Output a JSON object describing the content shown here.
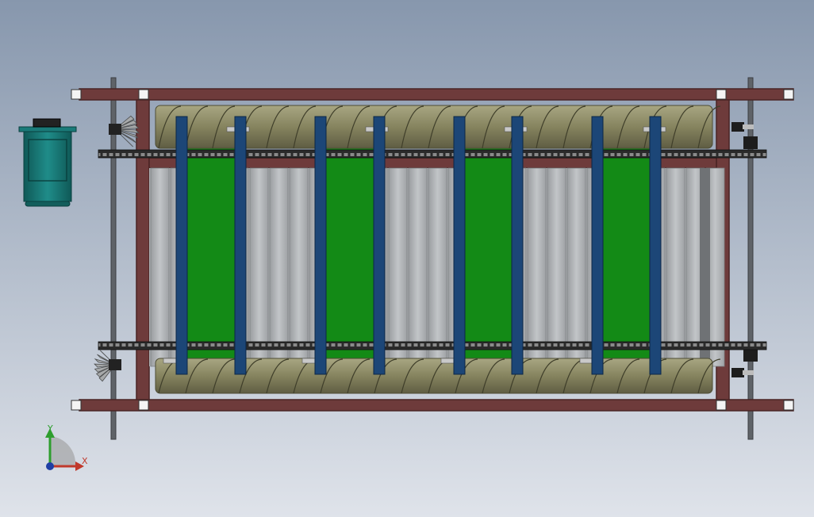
{
  "viewport": {
    "background_top": "#8797ad",
    "background_bottom": "#dfe3ea"
  },
  "model": {
    "frame_color": "#6e3b3b",
    "frame_dark": "#4a2424",
    "screw_color": "#8e8c68",
    "belt_color": "#138a16",
    "clamp_color": "#1c4677",
    "slat_color": "#b3b6b9",
    "chain_color": "#262626",
    "motor_color": "#1a7a78",
    "rail_color": "#5f6368",
    "bevel_gear_color": "#a7a9aa"
  },
  "triad": {
    "x_label": "X",
    "y_label": "Y",
    "x_color": "#c0392b",
    "y_color": "#2e9e2e",
    "z_color": "#1f3fa5"
  }
}
